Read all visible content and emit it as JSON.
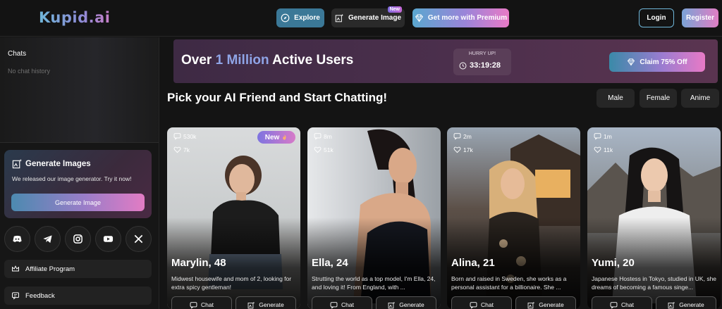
{
  "header": {
    "logo": "Kupid.ai",
    "explore_label": "Explore",
    "generate_label": "Generate Image",
    "generate_badge": "New",
    "premium_label": "Get more with Premium",
    "login_label": "Login",
    "register_label": "Register"
  },
  "sidebar": {
    "chats_title": "Chats",
    "chats_empty": "No chat history",
    "gen_card": {
      "title": "Generate Images",
      "text": "We released our image generator. Try it now!",
      "button": "Generate Image"
    },
    "socials": [
      "discord-icon",
      "telegram-icon",
      "instagram-icon",
      "youtube-icon",
      "x-icon"
    ],
    "affiliate_label": "Affiliate Program",
    "feedback_label": "Feedback"
  },
  "banner": {
    "text_pre": "Over ",
    "text_highlight": "1 Million",
    "text_post": " Active Users",
    "timer_label": "HURRY UP!",
    "timer_value": "33:19:28",
    "claim_label": "Claim 75% Off"
  },
  "main": {
    "title": "Pick your AI Friend and Start Chatting!",
    "filters": [
      "Male",
      "Female",
      "Anime"
    ]
  },
  "cards": [
    {
      "name": "Marylin, 48",
      "desc": "Midwest housewife and mom of 2, looking for extra spicy gentleman!",
      "chats": "530k",
      "likes": "7k",
      "badge": "New",
      "chat_label": "Chat",
      "generate_label": "Generate"
    },
    {
      "name": "Ella, 24",
      "desc": "Strutting the world as a top model, I'm Ella, 24, and loving it! From England, with ...",
      "chats": "8m",
      "likes": "51k",
      "chat_label": "Chat",
      "generate_label": "Generate"
    },
    {
      "name": "Alina, 21",
      "desc": "Born and raised in Sweden, she works as a personal assistant for a billionaire. She ...",
      "chats": "2m",
      "likes": "17k",
      "chat_label": "Chat",
      "generate_label": "Generate"
    },
    {
      "name": "Yumi, 20",
      "desc": "Japanese Hostess in Tokyo, studied in UK, she dreams of becoming a famous singe...",
      "chats": "1m",
      "likes": "11k",
      "chat_label": "Chat",
      "generate_label": "Generate"
    }
  ],
  "colors": {
    "accent_blue": "#3b7897",
    "accent_pink": "#e87ac6",
    "background": "#141414"
  }
}
